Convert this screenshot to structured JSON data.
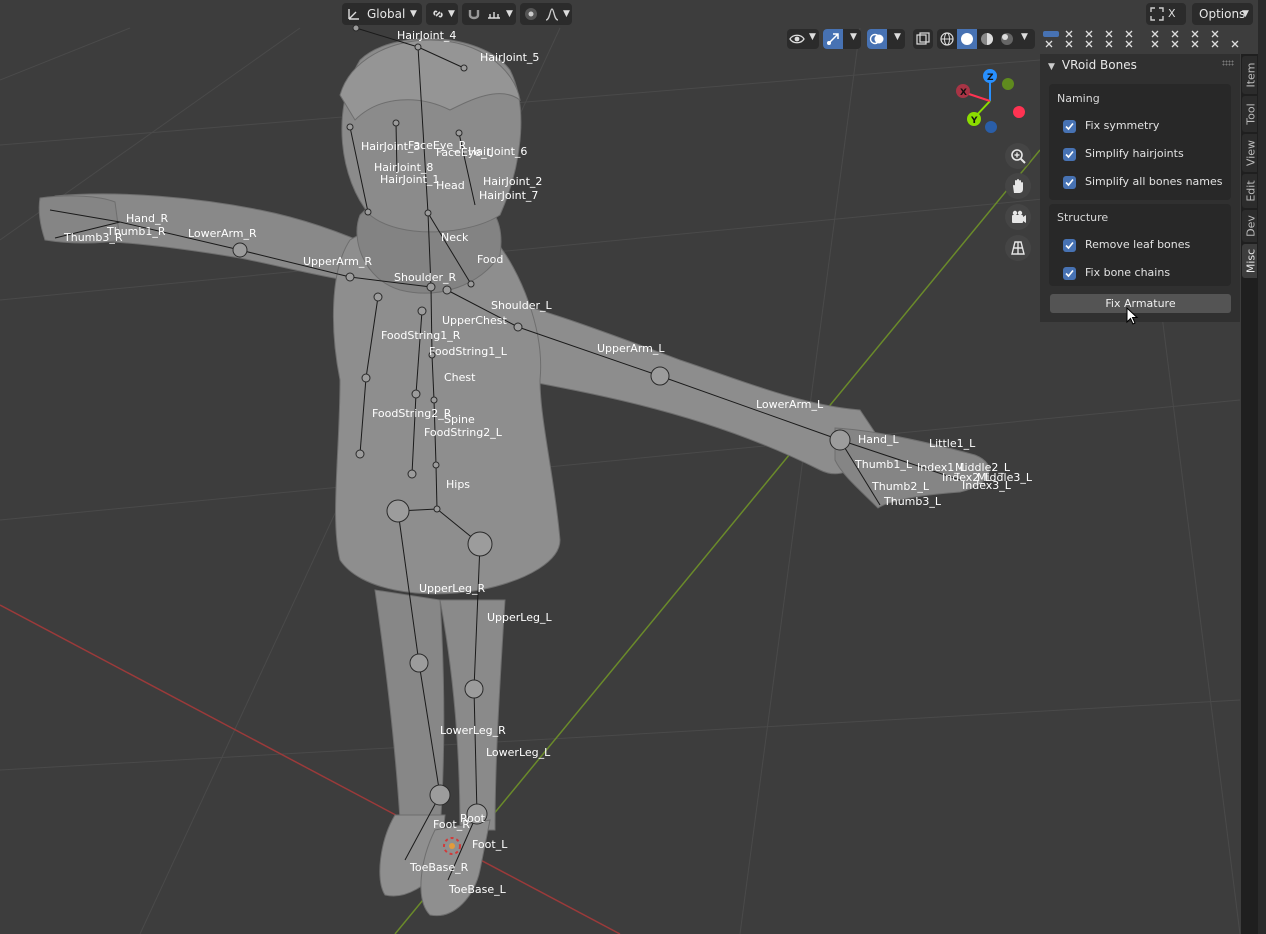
{
  "header": {
    "transform_orientation": "Global",
    "options_label": "Options",
    "close_label": "X"
  },
  "npanel": {
    "title": "VRoid Bones",
    "naming": {
      "heading": "Naming",
      "options": [
        "Fix symmetry",
        "Simplify hairjoints",
        "Simplify all bones names"
      ]
    },
    "structure": {
      "heading": "Structure",
      "options": [
        "Remove leaf bones",
        "Fix bone chains"
      ]
    },
    "fix_button": "Fix Armature"
  },
  "tabs": [
    "Item",
    "Tool",
    "View",
    "Edit",
    "Dev",
    "Misc"
  ],
  "gizmo": {
    "x": "X",
    "y": "Y",
    "z": "Z"
  },
  "bones": {
    "HairJoint_4": "HairJoint_4",
    "HairJoint_5": "HairJoint_5",
    "HairJoint_3": "HairJoint_3",
    "FaceEye_R": "FaceEye_R",
    "FaceEye_L": "FaceEye_L",
    "HairJoint_6": "HairJoint_6",
    "HairJoint_8": "HairJoint_8",
    "HairJoint_1": "HairJoint_1",
    "Head": "Head",
    "HairJoint_2": "HairJoint_2",
    "HairJoint_7": "HairJoint_7",
    "Neck": "Neck",
    "Food": "Food",
    "Hand_R": "Hand_R",
    "Thumb1_R": "Thumb1_R",
    "Thumb3_R": "Thumb3_R",
    "LowerArm_R": "LowerArm_R",
    "UpperArm_R": "UpperArm_R",
    "Shoulder_R": "Shoulder_R",
    "Shoulder_L": "Shoulder_L",
    "UpperChest": "UpperChest",
    "FoodString1_R": "FoodString1_R",
    "FoodString1_L": "FoodString1_L",
    "Chest": "Chest",
    "FoodString2_R": "FoodString2_R",
    "Spine": "Spine",
    "FoodString2_L": "FoodString2_L",
    "UpperArm_L": "UpperArm_L",
    "LowerArm_L": "LowerArm_L",
    "Hand_L": "Hand_L",
    "Little1_L": "Little1_L",
    "Thumb1_L": "Thumb1_L",
    "Index1_L": "Index1_L",
    "Middle2_L": "Middle2_L",
    "Index2_L": "Index2_L",
    "Middle3_L": "Middle3_L",
    "Index3_L": "Index3_L",
    "Thumb2_L": "Thumb2_L",
    "Thumb3_L": "Thumb3_L",
    "Hips": "Hips",
    "UpperLeg_R": "UpperLeg_R",
    "UpperLeg_L": "UpperLeg_L",
    "LowerLeg_R": "LowerLeg_R",
    "LowerLeg_L": "LowerLeg_L",
    "Foot_R": "Foot_R",
    "Root": "Root",
    "Foot_L": "Foot_L",
    "ToeBase_R": "ToeBase_R",
    "ToeBase_L": "ToeBase_L"
  },
  "colors": {
    "viewport_bg": "#3d3d3d",
    "panel_bg": "#303030",
    "accent_blue": "#4772b3",
    "axis_x": "#ff3352",
    "axis_y": "#8bdc00",
    "axis_z": "#2890ff"
  }
}
